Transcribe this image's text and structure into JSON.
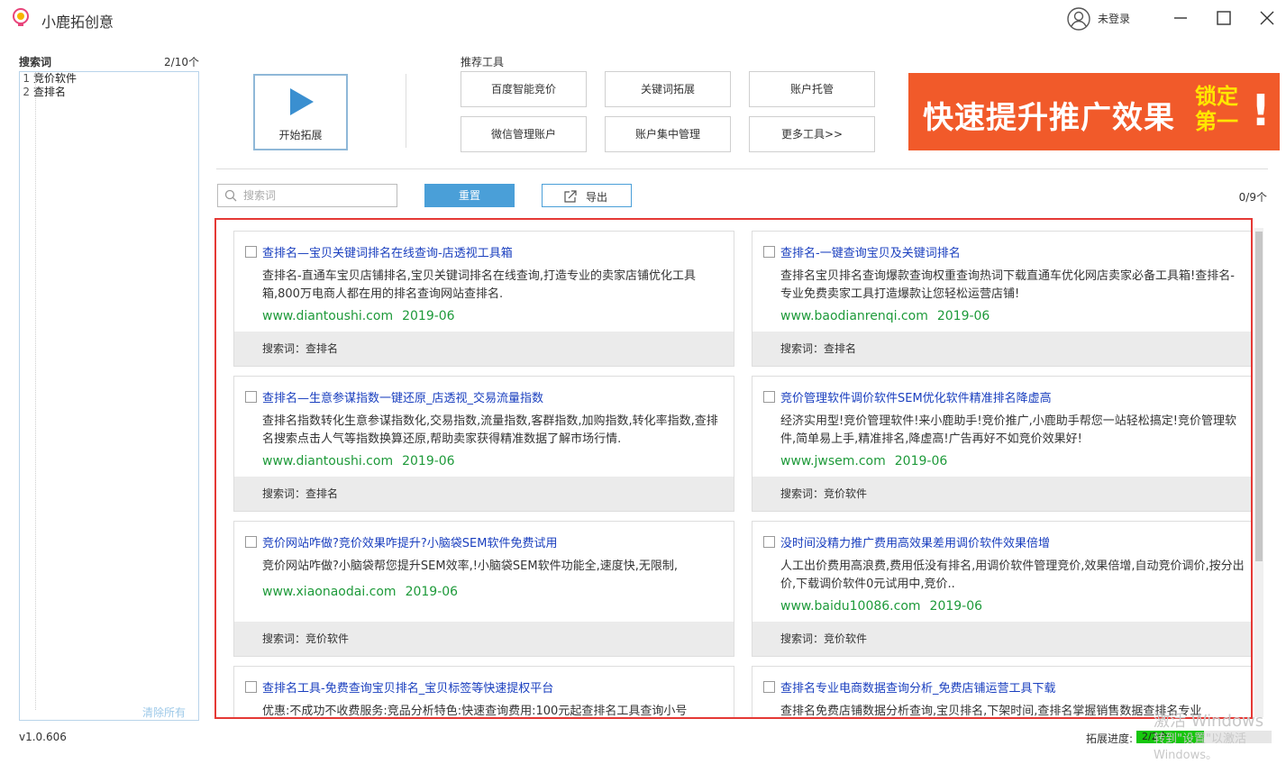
{
  "app": {
    "title": "小鹿拓创意",
    "login": "未登录",
    "version": "v1.0.606"
  },
  "sidebar": {
    "label": "搜索词",
    "count": "2/10个",
    "items": [
      {
        "num": "1",
        "text": "竞价软件"
      },
      {
        "num": "2",
        "text": "查排名"
      }
    ],
    "clear_all": "清除所有"
  },
  "toolbar": {
    "start_label": "开始拓展",
    "tools_label": "推荐工具",
    "tools": [
      "百度智能竞价",
      "关键词拓展",
      "账户托管",
      "微信管理账户",
      "账户集中管理",
      "更多工具>>"
    ]
  },
  "banner": {
    "main": "快速提升推广效果",
    "sub1": "锁定",
    "sub2": "第一",
    "bang": "!",
    "bg_color": "#f15a2a",
    "accent_color": "#ffe600"
  },
  "search": {
    "placeholder": "搜索词",
    "reset_label": "重置",
    "export_label": "导出",
    "result_count": "0/9个"
  },
  "cards": [
    {
      "title": "查排名—宝贝关键词排名在线查询-店透视工具箱",
      "desc": "查排名-直通车宝贝店铺排名,宝贝关键词排名在线查询,打造专业的卖家店铺优化工具箱,800万电商人都在用的排名查询网站查排名.",
      "url": "www.diantoushi.com",
      "date": "2019-06",
      "keyword": "搜索词：查排名"
    },
    {
      "title": "查排名-一键查询宝贝及关键词排名",
      "desc": "查排名宝贝排名查询爆款查询权重查询热词下载直通车优化网店卖家必备工具箱!查排名-专业免费卖家工具打造爆款让您轻松运营店铺!",
      "url": "www.baodianrenqi.com",
      "date": "2019-06",
      "keyword": "搜索词：查排名"
    },
    {
      "title": "查排名—生意参谋指数一键还原_店透视_交易流量指数",
      "desc": "查排名指数转化生意参谋指数化,交易指数,流量指数,客群指数,加购指数,转化率指数,查排名搜索点击人气等指数换算还原,帮助卖家获得精准数据了解市场行情.",
      "url": "www.diantoushi.com",
      "date": "2019-06",
      "keyword": "搜索词：查排名"
    },
    {
      "title": "竞价管理软件调价软件SEM优化软件精准排名降虚高",
      "desc": "经济实用型!竞价管理软件!来小鹿助手!竞价推广,小鹿助手帮您一站轻松搞定!竞价管理软件,简单易上手,精准排名,降虚高!广告再好不如竞价效果好!",
      "url": "www.jwsem.com",
      "date": "2019-06",
      "keyword": "搜索词：竞价软件"
    },
    {
      "title": "竞价网站咋做?竞价效果咋提升?小脑袋SEM软件免费试用",
      "desc": "竞价网站咋做?小脑袋帮您提升SEM效率,!小脑袋SEM软件功能全,速度快,无限制,",
      "url": "www.xiaonaodai.com",
      "date": "2019-06",
      "keyword": "搜索词：竞价软件"
    },
    {
      "title": "没时间没精力推广费用高效果差用调价软件效果倍增",
      "desc": "人工出价费用高浪费,费用低没有排名,用调价软件管理竞价,效果倍增,自动竞价调价,按分出价,下载调价软件0元试用中,竞价..",
      "url": "www.baidu10086.com",
      "date": "2019-06",
      "keyword": "搜索词：竞价软件"
    },
    {
      "title": "查排名工具-免费查询宝贝排名_宝贝标签等快速提权平台",
      "desc": "优惠:不成功不收费服务:竞品分析特色:快速查询费用:100元起查排名工具查询小号",
      "url": "",
      "date": "",
      "keyword": ""
    },
    {
      "title": "查排名专业电商数据查询分析_免费店铺运营工具下载",
      "desc": "查排名免费店铺数据分析查询,宝贝排名,下架时间,查排名掌握销售数据查排名专业",
      "url": "",
      "date": "",
      "keyword": ""
    }
  ],
  "progress": {
    "label": "拓展进度:",
    "text": "2/2个",
    "fraction": 0.5,
    "color": "#16c60c"
  },
  "watermark": {
    "line1": "激活 Windows",
    "line2": "转到\"设置\"以激活 Windows。"
  }
}
